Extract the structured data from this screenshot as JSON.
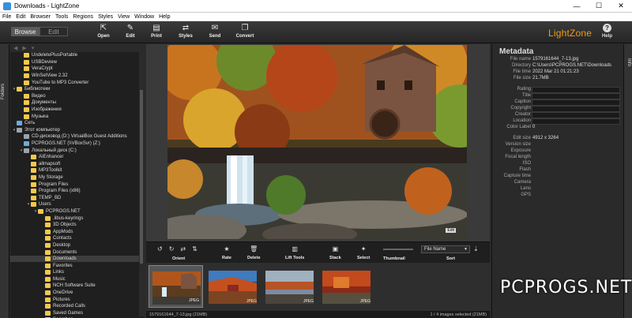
{
  "window": {
    "title": "Downloads - LightZone",
    "minimize": "—",
    "maximize": "☐",
    "close": "✕"
  },
  "menu": [
    "File",
    "Edit",
    "Browser",
    "Tools",
    "Regions",
    "Styles",
    "View",
    "Window",
    "Help"
  ],
  "mode_tabs": {
    "browse": "Browse",
    "edit": "Edit",
    "active": "browse"
  },
  "toolbar": [
    {
      "label": "Open",
      "icon": "open-icon"
    },
    {
      "label": "Edit",
      "icon": "edit-icon"
    },
    {
      "label": "Print",
      "icon": "print-icon"
    },
    {
      "label": "Styles",
      "icon": "styles-icon"
    },
    {
      "label": "Send",
      "icon": "send-icon"
    },
    {
      "label": "Convert",
      "icon": "convert-icon"
    }
  ],
  "brand": {
    "text": "LightZone",
    "color": "#f39c12"
  },
  "help": {
    "label": "Help"
  },
  "left_tab": "Folders",
  "right_tab": "Info",
  "tree": [
    {
      "label": "UndeletePlusPortable",
      "indent": 1,
      "type": "folder"
    },
    {
      "label": "USBDeview",
      "indent": 1,
      "type": "folder"
    },
    {
      "label": "VeraCrypt",
      "indent": 1,
      "type": "folder"
    },
    {
      "label": "WinSetView 2.32",
      "indent": 1,
      "type": "folder"
    },
    {
      "label": "YouTube to MP3 Converter",
      "indent": 1,
      "type": "folder"
    },
    {
      "label": "Библиотеки",
      "indent": 0,
      "type": "folder",
      "exp": "▾"
    },
    {
      "label": "Видео",
      "indent": 1,
      "type": "folder"
    },
    {
      "label": "Документы",
      "indent": 1,
      "type": "folder"
    },
    {
      "label": "Изображения",
      "indent": 1,
      "type": "folder"
    },
    {
      "label": "Музыка",
      "indent": 1,
      "type": "folder"
    },
    {
      "label": "Сеть",
      "indent": 0,
      "type": "net"
    },
    {
      "label": "Этот компьютер",
      "indent": 0,
      "type": "drive",
      "exp": "▾"
    },
    {
      "label": "CD-дисковод (D:) VirtualBox Guest Additions",
      "indent": 1,
      "type": "drive"
    },
    {
      "label": "PCPROGS.NET (\\\\VBoxSvr) (Z:)",
      "indent": 1,
      "type": "net"
    },
    {
      "label": "Локальный диск (C:)",
      "indent": 1,
      "type": "drive",
      "exp": "▾"
    },
    {
      "label": "AIEnhancer",
      "indent": 2,
      "type": "folder"
    },
    {
      "label": "allmapsoft",
      "indent": 2,
      "type": "folder"
    },
    {
      "label": "MP3Toolkit",
      "indent": 2,
      "type": "folder"
    },
    {
      "label": "My Storage",
      "indent": 2,
      "type": "folder"
    },
    {
      "label": "Program Files",
      "indent": 2,
      "type": "folder"
    },
    {
      "label": "Program Files (x86)",
      "indent": 2,
      "type": "folder"
    },
    {
      "label": "TEMP_BD",
      "indent": 2,
      "type": "folder"
    },
    {
      "label": "Users",
      "indent": 2,
      "type": "folder",
      "exp": "▾"
    },
    {
      "label": "PCPROGS.NET",
      "indent": 3,
      "type": "folder",
      "exp": "▾"
    },
    {
      "label": ".libus-keyrings",
      "indent": 4,
      "type": "folder"
    },
    {
      "label": "3D Objects",
      "indent": 4,
      "type": "folder"
    },
    {
      "label": "AppMods",
      "indent": 4,
      "type": "folder"
    },
    {
      "label": "Contacts",
      "indent": 4,
      "type": "folder"
    },
    {
      "label": "Desktop",
      "indent": 4,
      "type": "folder"
    },
    {
      "label": "Documents",
      "indent": 4,
      "type": "folder"
    },
    {
      "label": "Downloads",
      "indent": 4,
      "type": "folder",
      "selected": true
    },
    {
      "label": "Favorites",
      "indent": 4,
      "type": "folder"
    },
    {
      "label": "Links",
      "indent": 4,
      "type": "folder"
    },
    {
      "label": "Music",
      "indent": 4,
      "type": "folder"
    },
    {
      "label": "NCH Software Suite",
      "indent": 4,
      "type": "folder"
    },
    {
      "label": "OneDrive",
      "indent": 4,
      "type": "folder"
    },
    {
      "label": "Pictures",
      "indent": 4,
      "type": "folder"
    },
    {
      "label": "Recorded Calls",
      "indent": 4,
      "type": "folder"
    },
    {
      "label": "Saved Games",
      "indent": 4,
      "type": "folder"
    },
    {
      "label": "Searches",
      "indent": 4,
      "type": "folder"
    },
    {
      "label": "Videos",
      "indent": 4,
      "type": "folder"
    }
  ],
  "preview": {
    "badge": "Edit"
  },
  "bottom_tools": {
    "orient": "Orient",
    "rate": "Rate",
    "delete": "Delete",
    "lift": "Lift Tools",
    "stack": "Stack",
    "select": "Select",
    "thumbnail": "Thumbnail",
    "sort": "Sort",
    "sort_value": "File Name"
  },
  "thumbnails": [
    {
      "label": "JPEG",
      "selected": true
    },
    {
      "label": "JPEG",
      "selected": false
    },
    {
      "label": "JPEG",
      "selected": false
    },
    {
      "label": "JPEG",
      "selected": false
    }
  ],
  "status": {
    "left": "1579161644_7-13.jpg (21MB)",
    "right": "1 / 4 images selected (21MB)"
  },
  "metadata": {
    "title": "Metadata",
    "rows": [
      {
        "k": "File name",
        "v": "1579161644_7-13.jpg"
      },
      {
        "k": "Directory",
        "v": "C:\\Users\\PCPROGS.NET\\Downloads"
      },
      {
        "k": "File time",
        "v": "2022 Mar 21 01:21:23"
      },
      {
        "k": "File size",
        "v": "21.7MB"
      },
      {
        "k": "Rating",
        "box": true
      },
      {
        "k": "Title",
        "box": true
      },
      {
        "k": "Caption",
        "box": true
      },
      {
        "k": "Copyright",
        "box": true
      },
      {
        "k": "Creator",
        "box": true
      },
      {
        "k": "Location",
        "box": true
      },
      {
        "k": "Color Label",
        "v": "0"
      },
      {
        "k": "Edit size",
        "v": "4912 x 3264"
      },
      {
        "k": "Version size",
        "v": ""
      },
      {
        "k": "Exposure",
        "v": ""
      },
      {
        "k": "Focal length",
        "v": ""
      },
      {
        "k": "ISO",
        "v": ""
      },
      {
        "k": "Flash",
        "v": ""
      },
      {
        "k": "Capture time",
        "v": ""
      },
      {
        "k": "Camera",
        "v": ""
      },
      {
        "k": "Lens",
        "v": ""
      },
      {
        "k": "GPS",
        "v": ""
      }
    ]
  },
  "watermark": "PCPROGS.NET"
}
